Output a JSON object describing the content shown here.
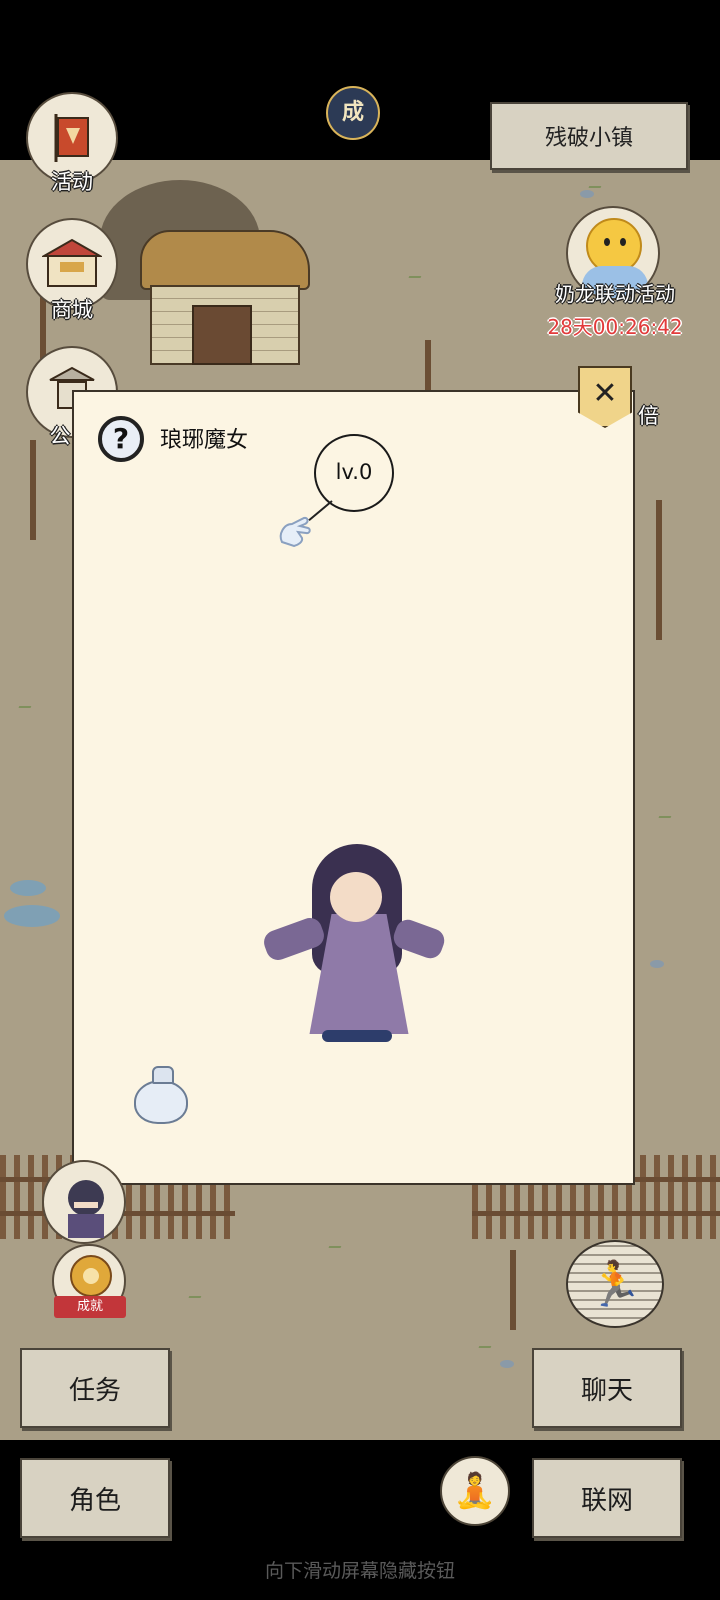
{
  "top": {
    "badge_glyph": "成",
    "location_label": "残破小镇"
  },
  "side_menu": {
    "activity_label": "活动",
    "shop_label": "商城",
    "notice_label": "公"
  },
  "event": {
    "label": "奶龙联动活动",
    "timer": "28天00:26:42"
  },
  "double_label": "倍",
  "dialog": {
    "enemy_name": "琅琊魔女",
    "level": "lv.0",
    "close_glyph": "✕",
    "help_glyph": "?"
  },
  "achievement_label": "成就",
  "bottom_menu": {
    "tasks": "任务",
    "chat": "聊天",
    "character": "角色",
    "network": "联网"
  },
  "run_glyph": "🏃",
  "meditate_glyph": "🧘",
  "hint": "向下滑动屏幕隐藏按钮",
  "colors": {
    "ground": "#aa9f87",
    "dialog_bg": "#fcf5e3",
    "timer_red": "#e23b3b",
    "button_bg": "#d8d2c2"
  }
}
